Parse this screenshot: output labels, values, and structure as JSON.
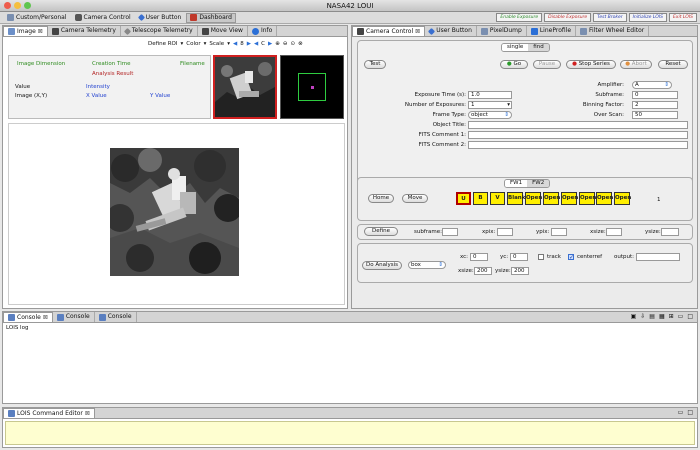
{
  "window": {
    "title": "NASA42 LOUI"
  },
  "toolbar": {
    "items": [
      "Custom/Personal",
      "Camera Control",
      "User Button",
      "Dashboard"
    ],
    "right_buttons": [
      "Enable Exposure",
      "Disable Exposure",
      "Test Broker",
      "Initialize LOIS",
      "Exit LOIS"
    ]
  },
  "left_tabs": [
    "Image",
    "Camera Telemetry",
    "Telescope Telemetry",
    "Move View",
    "Info"
  ],
  "image_toolbar": {
    "define_roi": "Define ROI",
    "color": "Color",
    "scale": "Scale",
    "step_value": "8",
    "channel": "C"
  },
  "info": {
    "image_dimension": "Image Dimension",
    "creation_time": "Creation Time",
    "filename": "Filename",
    "analysis_result": "Analysis Result",
    "value": "Value",
    "intensity": "Intensity",
    "image_xy": "Image (X,Y)",
    "x_value": "X Value",
    "y_value": "Y Value"
  },
  "right_tabs": [
    "Camera Control",
    "User Button",
    "PixelDump",
    "LineProfile",
    "Filter Wheel Editor"
  ],
  "camera": {
    "mode_tabs": [
      "single",
      "find"
    ],
    "test": "Test",
    "go": "Go",
    "pause": "Pause",
    "stop_series": "Stop Series",
    "abort": "Abort",
    "reset": "Reset",
    "exposure_time_label": "Exposure Time (s):",
    "exposure_time": "1.0",
    "num_exposures_label": "Number of Exposures:",
    "num_exposures": "1",
    "frame_type_label": "Frame Type:",
    "frame_type": "object",
    "object_title_label": "Object Title:",
    "fits1_label": "FITS Comment 1:",
    "fits2_label": "FITS Comment 2:",
    "amplifier_label": "Amplifier:",
    "amplifier": "A",
    "subframe_label": "Subframe:",
    "subframe": "0",
    "binning_label": "Binning Factor:",
    "binning": "2",
    "overscan_label": "Over Scan:",
    "overscan": "50"
  },
  "filter": {
    "tabs": [
      "FW1",
      "FW2"
    ],
    "home": "Home",
    "move": "Move",
    "slots": [
      "U",
      "B",
      "V",
      "Blank",
      "Open",
      "Open",
      "Open",
      "Open",
      "Open",
      "Open"
    ],
    "position": "1"
  },
  "define": {
    "button": "Define",
    "subframe": "subframe:",
    "xpix": "xpix:",
    "ypix": "ypix:",
    "xsize": "xsize:",
    "ysize": "ysize:"
  },
  "analysis": {
    "button": "Do Analysis",
    "method": "box",
    "xc_label": "xc:",
    "xc": "0",
    "yc_label": "yc:",
    "yc": "0",
    "track": "track",
    "centerref": "centerref",
    "output": "output:",
    "xsize_label": "xsize:",
    "xsize": "200",
    "ysize_label": "ysize:",
    "ysize": "200"
  },
  "console": {
    "tabs": [
      "Console",
      "Console",
      "Console"
    ],
    "log_title": "LOIS log"
  },
  "command_editor": {
    "tab": "LOIS Command Editor"
  },
  "colors": {
    "highlight": "#ffef00",
    "blue_text": "#1f3fcf",
    "green_text": "#2e8b1f",
    "red_text": "#b22222"
  }
}
